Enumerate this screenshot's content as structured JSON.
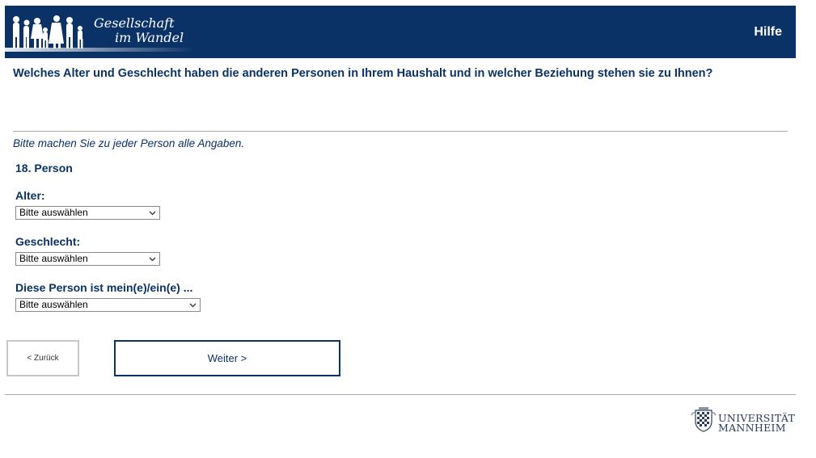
{
  "header": {
    "logo_line1": "Gesellschaft",
    "logo_line2": "im Wandel",
    "help_label": "Hilfe"
  },
  "question": "Welches Alter und Geschlecht haben die anderen Personen in Ihrem Haushalt und in welcher Beziehung stehen sie zu Ihnen?",
  "instruction": "Bitte machen Sie zu jeder Person alle Angaben.",
  "person": {
    "title": "18. Person",
    "fields": [
      {
        "label": "Alter:",
        "value": "Bitte auswählen"
      },
      {
        "label": "Geschlecht:",
        "value": "Bitte auswählen"
      },
      {
        "label": "Diese Person ist mein(e)/ein(e) ...",
        "value": "Bitte auswählen"
      }
    ]
  },
  "nav": {
    "back_label": "< Zurück",
    "next_label": "Weiter >"
  },
  "footer": {
    "uni_line1": "UNIVERSITÄT",
    "uni_line2": "MANNHEIM"
  },
  "colors": {
    "brand": "#0b3266",
    "divider": "#a9a9a9"
  }
}
